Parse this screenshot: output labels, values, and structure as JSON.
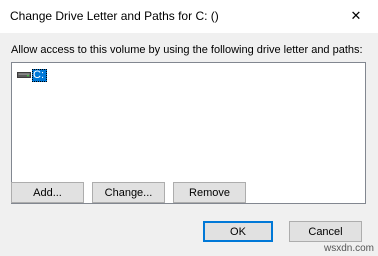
{
  "window": {
    "title": "Change Drive Letter and Paths for C: ()",
    "close_glyph": "✕"
  },
  "instruction": "Allow access to this volume by using the following drive letter and paths:",
  "list": {
    "items": [
      {
        "label": "C:",
        "icon": "drive-icon",
        "selected": true
      }
    ]
  },
  "buttons": {
    "add": "Add...",
    "change": "Change...",
    "remove": "Remove",
    "ok": "OK",
    "cancel": "Cancel"
  },
  "watermark": "wsxdn.com",
  "colors": {
    "selection": "#0078d7",
    "dialog_bg": "#f0f0f0"
  }
}
